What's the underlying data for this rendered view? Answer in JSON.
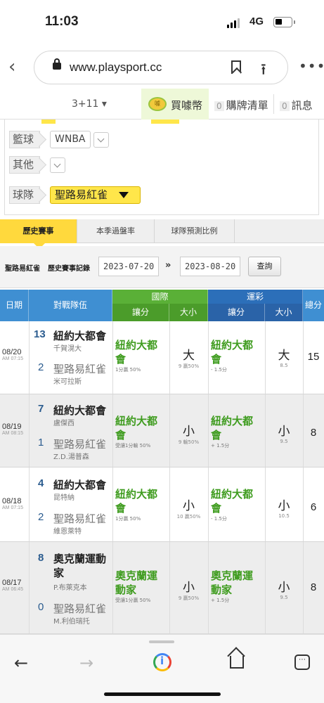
{
  "status": {
    "time": "11:03",
    "network": "4G"
  },
  "browser": {
    "url": "www.playsport.cc"
  },
  "sitenav": {
    "selector": "3+11",
    "buy_label": "買噱幣",
    "coin_text": "噱",
    "cart_count": "0",
    "cart_label": "購牌清單",
    "msg_count": "0",
    "msg_label": "訊息"
  },
  "filters": {
    "basketball_label": "籃球",
    "basketball_value": "WNBA",
    "other_label": "其他",
    "team_label": "球隊",
    "team_value": "聖路易紅雀"
  },
  "tabs": [
    "歷史賽事",
    "本季過盤率",
    "球隊預測比例"
  ],
  "search": {
    "team": "聖路易紅雀",
    "record_label": "歷史賽事記錄",
    "from": "2023-07-20",
    "arrow": "»",
    "to": "2023-08-20",
    "button": "查詢"
  },
  "table": {
    "headers": {
      "date": "日期",
      "matchup": "對戰隊伍",
      "intl": "國際",
      "lottery": "運彩",
      "spread": "讓分",
      "ou": "大小",
      "spread2": "讓分",
      "ou2": "大小",
      "total": "總分"
    },
    "rows": [
      {
        "date": "08/20",
        "time": "AM 07:15",
        "score_a": "13",
        "team_a": "紐約大都會",
        "pitcher_a": "千賀滉大",
        "score_b": "2",
        "team_b": "聖路易紅雀",
        "pitcher_b": "米可拉斯",
        "intl_pick": "紐約大都會",
        "intl_note": "1分贏 50%",
        "intl_ou": "大",
        "intl_ou_note": "9 贏50%",
        "lot_pick": "紐約大都會",
        "lot_note": "- 1.5分",
        "lot_ou": "大",
        "lot_ou_note": "8.5",
        "total": "15"
      },
      {
        "date": "08/19",
        "time": "AM 08:15",
        "score_a": "7",
        "team_a": "紐約大都會",
        "pitcher_a": "盧傑西",
        "score_b": "1",
        "team_b": "聖路易紅雀",
        "pitcher_b": "Z.D.湯普森",
        "intl_pick": "紐約大都會",
        "intl_note": "受讓1分輸 50%",
        "intl_ou": "小",
        "intl_ou_note": "9 輸50%",
        "lot_pick": "紐約大都會",
        "lot_note": "+ 1.5分",
        "lot_ou": "小",
        "lot_ou_note": "9.5",
        "total": "8"
      },
      {
        "date": "08/18",
        "time": "AM 07:15",
        "score_a": "4",
        "team_a": "紐約大都會",
        "pitcher_a": "昆特納",
        "score_b": "2",
        "team_b": "聖路易紅雀",
        "pitcher_b": "維恩萊特",
        "intl_pick": "紐約大都會",
        "intl_note": "1分贏 50%",
        "intl_ou": "小",
        "intl_ou_note": "10 贏50%",
        "lot_pick": "紐約大都會",
        "lot_note": "- 1.5分",
        "lot_ou": "小",
        "lot_ou_note": "10.5",
        "total": "6"
      },
      {
        "date": "08/17",
        "time": "AM 06:45",
        "score_a": "8",
        "team_a": "奧克蘭運動家",
        "pitcher_a": "P.布萊克本",
        "score_b": "0",
        "team_b": "聖路易紅雀",
        "pitcher_b": "M.利伯瑞托",
        "intl_pick": "奧克蘭運動家",
        "intl_note": "受讓1分贏 50%",
        "intl_ou": "小",
        "intl_ou_note": "9 贏50%",
        "lot_pick": "奧克蘭運動家",
        "lot_note": "+ 1.5分",
        "lot_ou": "小",
        "lot_ou_note": "9.5",
        "total": "8"
      }
    ]
  },
  "colors": {
    "pick_green": "#3f9c1f",
    "header_blue": "#3f8fd2",
    "header_green": "#5ab037",
    "tab_active": "#ffd93d",
    "team_select": "#ffe64a"
  },
  "icons": {
    "back": "chevron-left-icon",
    "lock": "lock-icon",
    "bookmark": "bookmark-icon",
    "share": "share-icon",
    "more": "more-icon",
    "nav_back": "arrow-left-icon",
    "nav_forward": "arrow-right-icon",
    "google": "google-lens-icon",
    "home": "home-icon",
    "tabs": "tabs-icon"
  }
}
